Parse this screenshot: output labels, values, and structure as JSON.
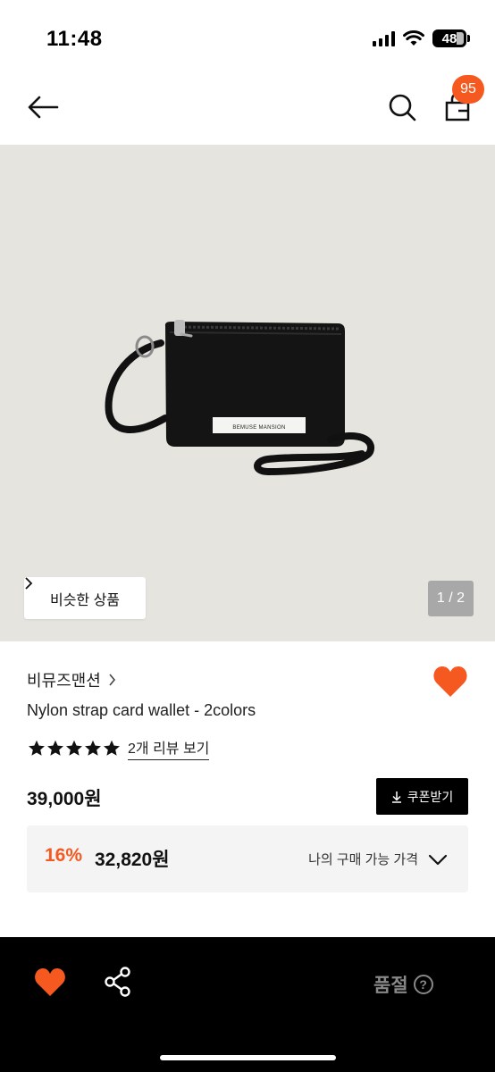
{
  "status_bar": {
    "time": "11:48",
    "battery": "48",
    "icons": [
      "signal-icon",
      "wifi-icon",
      "battery-icon"
    ]
  },
  "nav": {
    "icons": [
      "back-arrow-icon",
      "search-icon",
      "shopping-bag-icon"
    ],
    "cart_count": "95"
  },
  "hero": {
    "similar_button_label": "비슷한 상품",
    "page_indicator": "1 / 2",
    "product_tag_text": "BEMUSE MANSION",
    "image_description_icon": "black-card-wallet-photo"
  },
  "product": {
    "brand": "비뮤즈맨션",
    "name": "Nylon strap card wallet - 2colors",
    "rating_stars": 5,
    "review_link": "2개 리뷰 보기",
    "price": "39,000원",
    "coupon_label": "쿠폰받기",
    "discount_rate": "16%",
    "discount_price": "32,820원",
    "my_price_label": "나의 구매 가능 가격",
    "wishlisted": true
  },
  "bottom_bar": {
    "status_label": "품절",
    "help_symbol": "?",
    "icons": [
      "heart-icon",
      "share-icon",
      "help-icon"
    ]
  },
  "colors": {
    "accent": "#f5591f",
    "hero_background": "#e6e4df",
    "bottom_bar": "#000000",
    "soldout_text": "#888888"
  }
}
